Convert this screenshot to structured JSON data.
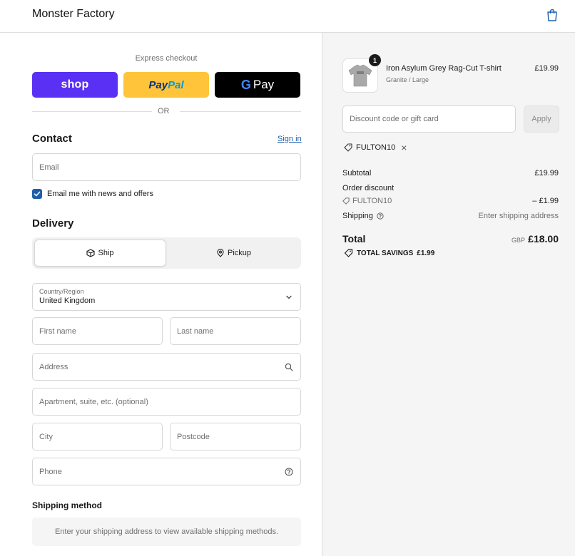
{
  "header": {
    "brand": "Monster Factory"
  },
  "express": {
    "label": "Express checkout",
    "shop_label": "shop",
    "paypal_part1": "Pay",
    "paypal_part2": "Pal",
    "gpay_label": "Pay",
    "or_label": "OR"
  },
  "contact": {
    "title": "Contact",
    "signin": "Sign in",
    "email_placeholder": "Email",
    "newsletter_label": "Email me with news and offers",
    "newsletter_checked": true
  },
  "delivery": {
    "title": "Delivery",
    "tabs": [
      {
        "label": "Ship",
        "selected": true
      },
      {
        "label": "Pickup",
        "selected": false
      }
    ],
    "country_label": "Country/Region",
    "country_value": "United Kingdom",
    "first_name_placeholder": "First name",
    "last_name_placeholder": "Last name",
    "address_placeholder": "Address",
    "apartment_placeholder": "Apartment, suite, etc. (optional)",
    "city_placeholder": "City",
    "postcode_placeholder": "Postcode",
    "phone_placeholder": "Phone"
  },
  "shipping_method": {
    "title": "Shipping method",
    "note": "Enter your shipping address to view available shipping methods."
  },
  "order": {
    "item": {
      "quantity": "1",
      "name": "Iron Asylum Grey Rag-Cut T-shirt",
      "variant": "Granite / Large",
      "price": "£19.99"
    },
    "discount_placeholder": "Discount code or gift card",
    "apply_label": "Apply",
    "applied_code": "FULTON10",
    "subtotal_label": "Subtotal",
    "subtotal_value": "£19.99",
    "order_discount_label": "Order discount",
    "order_discount_code": "FULTON10",
    "order_discount_value": "– £1.99",
    "shipping_label": "Shipping",
    "shipping_value": "Enter shipping address",
    "total_label": "Total",
    "currency": "GBP",
    "total_value": "£18.00",
    "savings_label": "TOTAL SAVINGS",
    "savings_value": "£1.99"
  },
  "colors": {
    "shop_purple": "#5a31f4",
    "paypal_yellow": "#ffc439",
    "link_blue": "#1f5fa8",
    "panel_bg": "#f5f5f5"
  }
}
